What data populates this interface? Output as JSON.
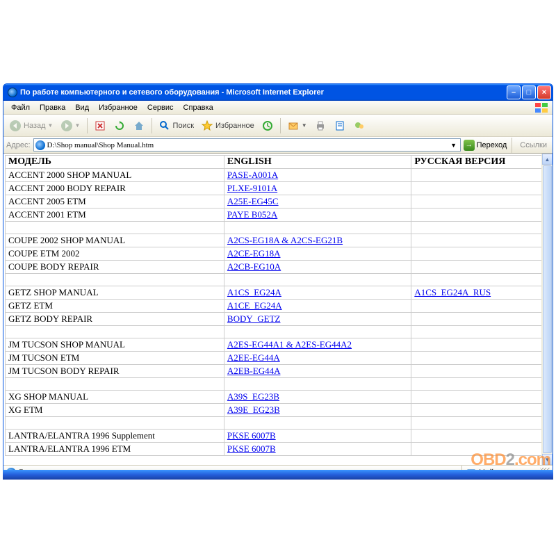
{
  "window": {
    "title": "По работе компьютерного и сетевого оборудования - Microsoft Internet Explorer"
  },
  "menubar": {
    "file": "Файл",
    "edit": "Правка",
    "view": "Вид",
    "favorites": "Избранное",
    "tools": "Сервис",
    "help": "Справка"
  },
  "toolbar": {
    "back": "Назад",
    "search": "Поиск",
    "favorites": "Избранное"
  },
  "addrbar": {
    "label": "Адрес:",
    "value": "D:\\Shop manual\\Shop Manual.htm",
    "go": "Переход",
    "links": "Ссылки"
  },
  "table": {
    "headers": {
      "model": "МОДЕЛЬ",
      "english": "ENGLISH",
      "russian": "РУССКАЯ ВЕРСИЯ"
    },
    "rows": [
      {
        "model": "ACCENT 2000 SHOP MANUAL",
        "english": "PASE-A001A",
        "russian": ""
      },
      {
        "model": "ACCENT 2000 BODY REPAIR",
        "english": "PLXE-9101A",
        "russian": ""
      },
      {
        "model": "ACCENT 2005 ETM",
        "english": "A25E-EG45C",
        "russian": ""
      },
      {
        "model": "ACCENT 2001 ETM",
        "english": "PAYE B052A",
        "russian": ""
      },
      {
        "spacer": true
      },
      {
        "model": "COUPE 2002 SHOP MANUAL",
        "english": "A2CS-EG18A & A2CS-EG21B",
        "russian": ""
      },
      {
        "model": "COUPE ETM 2002",
        "english": "A2CE-EG18A",
        "russian": ""
      },
      {
        "model": "COUPE BODY REPAIR",
        "english": "A2CB-EG10A",
        "russian": ""
      },
      {
        "spacer": true
      },
      {
        "model": "GETZ SHOP MANUAL",
        "english": "A1CS_EG24A",
        "russian": "A1CS_EG24A_RUS"
      },
      {
        "model": "GETZ ETM",
        "english": "A1CE_EG24A",
        "russian": ""
      },
      {
        "model": "GETZ BODY REPAIR",
        "english": "BODY_GETZ",
        "russian": ""
      },
      {
        "spacer": true
      },
      {
        "model": "JM TUCSON SHOP MANUAL",
        "english": "A2ES-EG44A1 & A2ES-EG44A2",
        "russian": ""
      },
      {
        "model": "JM TUCSON ETM",
        "english": "A2EE-EG44A",
        "russian": ""
      },
      {
        "model": "JM TUCSON BODY REPAIR",
        "english": "A2EB-EG44A",
        "russian": ""
      },
      {
        "spacer": true
      },
      {
        "model": "XG SHOP MANUAL",
        "english": "A39S_EG23B",
        "russian": ""
      },
      {
        "model": "XG ETM",
        "english": "A39E_EG23B",
        "russian": ""
      },
      {
        "spacer": true
      },
      {
        "model": "LANTRA/ELANTRA 1996 Supplement",
        "english": "PKSE 6007B",
        "russian": ""
      },
      {
        "model": "LANTRA/ELANTRA 1996 ETM",
        "english": "PKSE 6007B",
        "russian": ""
      }
    ]
  },
  "statusbar": {
    "status": "Готово",
    "zone": "Мой компьютер"
  },
  "watermark": {
    "a": "OBD",
    "b": "2",
    "c": ".com"
  }
}
